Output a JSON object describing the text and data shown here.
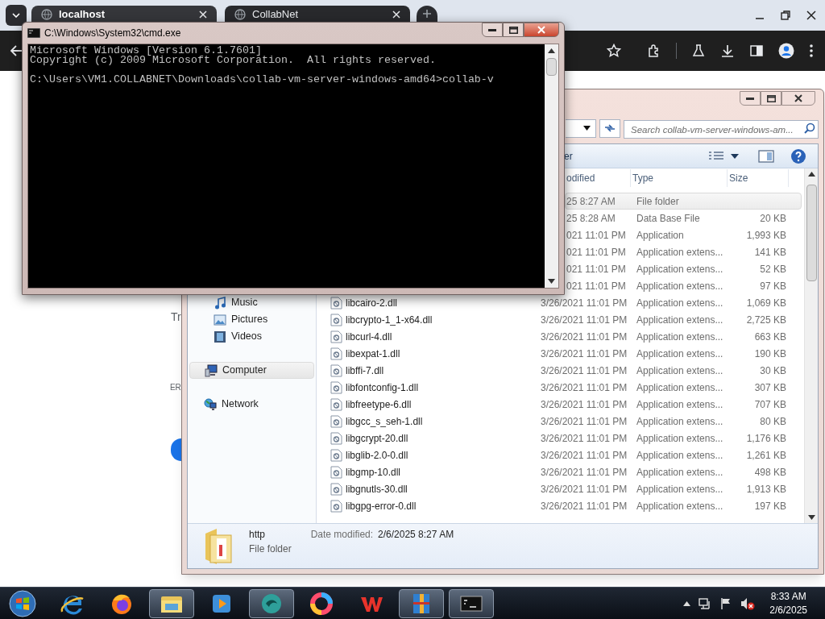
{
  "browser": {
    "tabs": [
      {
        "title": "localhost",
        "selected": true
      },
      {
        "title": "CollabNet",
        "selected": false
      }
    ],
    "page_texts": [
      "Tr",
      "ER"
    ]
  },
  "explorer": {
    "search": {
      "placeholder": "Search collab-vm-server-windows-am..."
    },
    "command_text": "er",
    "columns": [
      "odified",
      "Type",
      "Size"
    ],
    "nav": [
      {
        "label": "Music",
        "kind": "music",
        "selected": false
      },
      {
        "label": "Pictures",
        "kind": "pictures",
        "selected": false
      },
      {
        "label": "Videos",
        "kind": "videos",
        "selected": false
      },
      {
        "label": "Computer",
        "kind": "computer",
        "selected": true
      },
      {
        "label": "Network",
        "kind": "network",
        "selected": false
      }
    ],
    "rows": [
      {
        "date": "25 8:27 AM",
        "type": "File folder",
        "selected": true
      },
      {
        "date": "25 8:28 AM",
        "type": "Data Base File",
        "size": "20 KB",
        "selected": false
      },
      {
        "date": "021 11:01 PM",
        "type": "Application",
        "size": "1,993 KB",
        "selected": false
      },
      {
        "date": "021 11:01 PM",
        "type": "Application extens...",
        "size": "141 KB",
        "selected": false
      },
      {
        "date": "021 11:01 PM",
        "type": "Application extens...",
        "size": "52 KB",
        "selected": false
      },
      {
        "date": "021 11:01 PM",
        "type": "Application extens...",
        "size": "97 KB",
        "selected": false
      },
      {
        "name": "libcairo-2.dll",
        "date": "3/26/2021 11:01 PM",
        "type": "Application extens...",
        "size": "1,069 KB",
        "selected": false
      },
      {
        "name": "libcrypto-1_1-x64.dll",
        "date": "3/26/2021 11:01 PM",
        "type": "Application extens...",
        "size": "2,725 KB",
        "selected": false
      },
      {
        "name": "libcurl-4.dll",
        "date": "3/26/2021 11:01 PM",
        "type": "Application extens...",
        "size": "663 KB",
        "selected": false
      },
      {
        "name": "libexpat-1.dll",
        "date": "3/26/2021 11:01 PM",
        "type": "Application extens...",
        "size": "190 KB",
        "selected": false
      },
      {
        "name": "libffi-7.dll",
        "date": "3/26/2021 11:01 PM",
        "type": "Application extens...",
        "size": "30 KB",
        "selected": false
      },
      {
        "name": "libfontconfig-1.dll",
        "date": "3/26/2021 11:01 PM",
        "type": "Application extens...",
        "size": "307 KB",
        "selected": false
      },
      {
        "name": "libfreetype-6.dll",
        "date": "3/26/2021 11:01 PM",
        "type": "Application extens...",
        "size": "707 KB",
        "selected": false
      },
      {
        "name": "libgcc_s_seh-1.dll",
        "date": "3/26/2021 11:01 PM",
        "type": "Application extens...",
        "size": "80 KB",
        "selected": false
      },
      {
        "name": "libgcrypt-20.dll",
        "date": "3/26/2021 11:01 PM",
        "type": "Application extens...",
        "size": "1,176 KB",
        "selected": false
      },
      {
        "name": "libglib-2.0-0.dll",
        "date": "3/26/2021 11:01 PM",
        "type": "Application extens...",
        "size": "1,261 KB",
        "selected": false
      },
      {
        "name": "libgmp-10.dll",
        "date": "3/26/2021 11:01 PM",
        "type": "Application extens...",
        "size": "498 KB",
        "selected": false
      },
      {
        "name": "libgnutls-30.dll",
        "date": "3/26/2021 11:01 PM",
        "type": "Application extens...",
        "size": "1,913 KB",
        "selected": false
      },
      {
        "name": "libgpg-error-0.dll",
        "date": "3/26/2021 11:01 PM",
        "type": "Application extens...",
        "size": "197 KB",
        "selected": false
      }
    ],
    "details": {
      "name": "http",
      "type": "File folder",
      "date_label": "Date modified:",
      "date": "2/6/2025 8:27 AM"
    }
  },
  "cmd": {
    "title": "C:\\Windows\\System32\\cmd.exe",
    "lines": [
      "Microsoft Windows [Version 6.1.7601]",
      "Copyright (c) 2009 Microsoft Corporation.  All rights reserved."
    ],
    "prompt": "C:\\Users\\VM1.COLLABNET\\Downloads\\collab-vm-server-windows-amd64>collab-v"
  },
  "taskbar": {
    "apps": [
      {
        "kind": "ie",
        "running": false
      },
      {
        "kind": "firefox",
        "running": false
      },
      {
        "kind": "explorer",
        "running": true
      },
      {
        "kind": "media",
        "running": false
      },
      {
        "kind": "teal",
        "running": true
      },
      {
        "kind": "ring",
        "running": false
      },
      {
        "kind": "wps",
        "running": false
      },
      {
        "kind": "archive",
        "running": true
      },
      {
        "kind": "cmd",
        "running": true
      }
    ],
    "time": "8:33 AM",
    "date": "2/6/2025"
  }
}
